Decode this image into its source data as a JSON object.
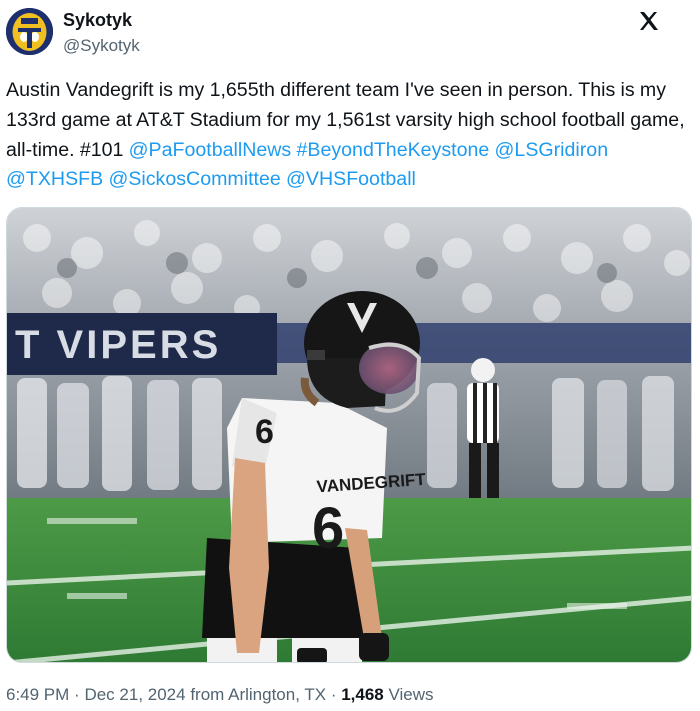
{
  "author": {
    "display_name": "Sykotyk",
    "handle": "@Sykotyk",
    "avatar_icon": "helmet-avatar-icon"
  },
  "brand": {
    "logo_icon": "x-logo-icon"
  },
  "tweet": {
    "text_plain_1": "Austin Vandegrift is my 1,655th different team I've seen in person. This is my 133rd game at AT&T Stadium for my 1,561st varsity high school football game, all-time. #101",
    "links": [
      "@PaFootballNews",
      "#BeyondTheKeystone",
      "@LSGridiron",
      "@TXHSFB",
      "@SickosCommittee",
      "@VHSFootball"
    ]
  },
  "media": {
    "description_icon": "football-player-photo",
    "banner_text": "T VIPERS",
    "helmet_letter": "V",
    "jersey_number": "6",
    "jersey_name": "VANDEGRIFT"
  },
  "meta": {
    "time": "6:49 PM",
    "separator": "·",
    "date": "Dec 21, 2024",
    "location": "from Arlington, TX",
    "views_count": "1,468",
    "views_label": "Views"
  },
  "colors": {
    "link": "#1d9bf0",
    "text": "#0f1419",
    "secondary": "#536471",
    "field_green": "#3f8a3e",
    "banner_navy": "#1f2a4a"
  }
}
